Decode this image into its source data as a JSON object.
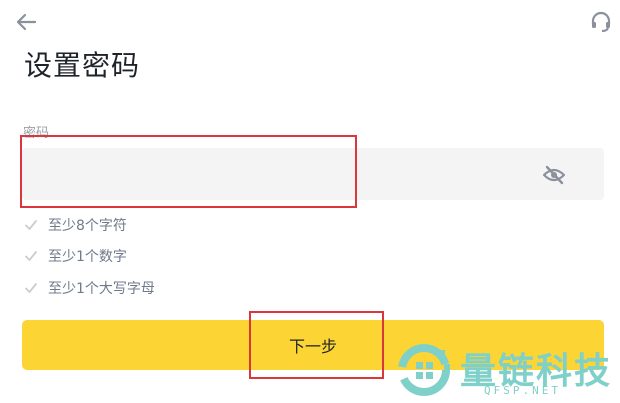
{
  "header": {
    "back_icon": "arrow-left-icon",
    "support_icon": "headset-icon",
    "title": "设置密码"
  },
  "password_field": {
    "label": "密码",
    "value": "",
    "placeholder": "",
    "visibility_icon": "eye-off-icon"
  },
  "requirements": [
    {
      "label": "至少8个字符",
      "met": false
    },
    {
      "label": "至少1个数字",
      "met": false
    },
    {
      "label": "至少1个大写字母",
      "met": false
    }
  ],
  "next_button": {
    "label": "下一步"
  },
  "watermark": {
    "name": "量链科技",
    "domain": "QFSP.NET"
  },
  "colors": {
    "accent": "#FCD535",
    "input_bg": "#F4F4F4",
    "annotation": "#D9363E",
    "watermark": "#7FD0C8"
  }
}
